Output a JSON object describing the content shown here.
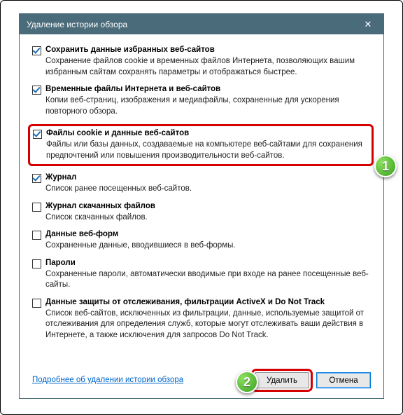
{
  "window": {
    "title": "Удаление истории обзора",
    "close": "✕"
  },
  "options": [
    {
      "checked": true,
      "highlight": false,
      "title": "Сохранить данные избранных веб-сайтов",
      "desc": "Сохранение файлов cookie и временных файлов Интернета, позволяющих вашим избранным сайтам сохранять параметры и отображаться быстрее."
    },
    {
      "checked": true,
      "highlight": false,
      "title": "Временные файлы Интернета и веб-сайтов",
      "desc": "Копии веб-страниц, изображения и медиафайлы, сохраненные для ускорения повторного обзора."
    },
    {
      "checked": true,
      "highlight": true,
      "title": "Файлы cookie и данные веб-сайтов",
      "desc": "Файлы или базы данных, создаваемые на компьютере веб-сайтами для сохранения предпочтений или повышения производительности веб-сайтов."
    },
    {
      "checked": true,
      "highlight": false,
      "title": "Журнал",
      "desc": "Список ранее посещенных веб-сайтов."
    },
    {
      "checked": false,
      "highlight": false,
      "title": "Журнал скачанных файлов",
      "desc": "Список скачанных файлов."
    },
    {
      "checked": false,
      "highlight": false,
      "title": "Данные веб-форм",
      "desc": "Сохраненные данные, вводившиеся в веб-формы."
    },
    {
      "checked": false,
      "highlight": false,
      "title": "Пароли",
      "desc": "Сохраненные пароли, автоматически вводимые при входе на ранее посещенные веб-сайты."
    },
    {
      "checked": false,
      "highlight": false,
      "title": "Данные защиты от отслеживания, фильтрации ActiveX и Do Not Track",
      "desc": "Список веб-сайтов, исключенных из фильтрации, данные, используемые защитой от отслеживания для определения служб, которые могут отслеживать ваши действия в Интернете, а также исключения для запросов Do Not Track."
    }
  ],
  "link": "Подробнее об удалении истории обзора",
  "buttons": {
    "delete": "Удалить",
    "cancel": "Отмена"
  },
  "badges": {
    "one": "1",
    "two": "2"
  }
}
